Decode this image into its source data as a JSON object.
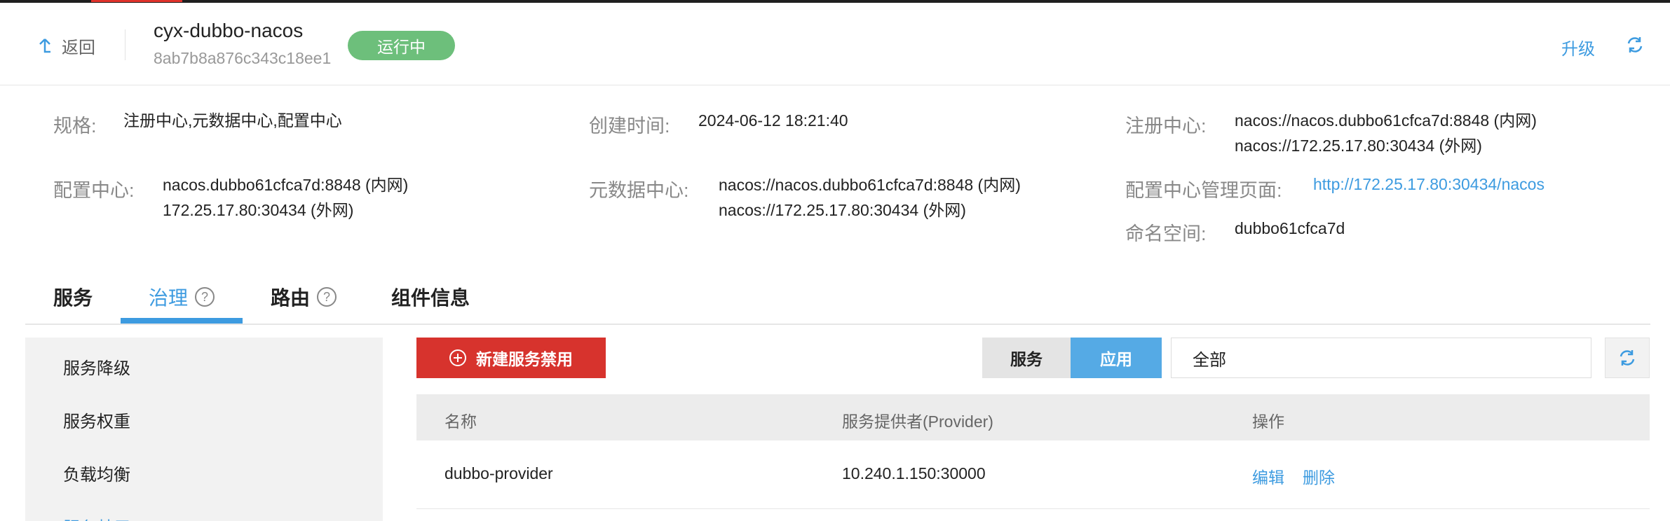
{
  "header": {
    "back_label": "返回",
    "instance_name": "cyx-dubbo-nacos",
    "instance_id": "8ab7b8a876c343c18ee1",
    "status": "运行中",
    "upgrade_label": "升级"
  },
  "info": {
    "spec_label": "规格:",
    "spec_value": "注册中心,元数据中心,配置中心",
    "created_label": "创建时间:",
    "created_value": "2024-06-12 18:21:40",
    "registry_label": "注册中心:",
    "registry_internal": "nacos://nacos.dubbo61cfca7d:8848 (内网)",
    "registry_external": "nacos://172.25.17.80:30434 (外网)",
    "config_label": "配置中心:",
    "config_internal": "nacos.dubbo61cfca7d:8848 (内网)",
    "config_external": "172.25.17.80:30434 (外网)",
    "metadata_label": "元数据中心:",
    "metadata_internal": "nacos://nacos.dubbo61cfca7d:8848 (内网)",
    "metadata_external": "nacos://172.25.17.80:30434 (外网)",
    "config_page_label": "配置中心管理页面:",
    "config_page_url": "http://172.25.17.80:30434/nacos",
    "namespace_label": "命名空间:",
    "namespace_value": "dubbo61cfca7d"
  },
  "tabs": [
    {
      "label": "服务"
    },
    {
      "label": "治理"
    },
    {
      "label": "路由"
    },
    {
      "label": "组件信息"
    }
  ],
  "sidebar": {
    "items": [
      {
        "label": "服务降级"
      },
      {
        "label": "服务权重"
      },
      {
        "label": "负载均衡"
      },
      {
        "label": "服务禁用"
      }
    ]
  },
  "toolbar": {
    "new_button": "新建服务禁用",
    "seg_service": "服务",
    "seg_app": "应用",
    "filter_value": "全部"
  },
  "table": {
    "columns": [
      "名称",
      "服务提供者(Provider)",
      "操作"
    ],
    "rows": [
      {
        "name": "dubbo-provider",
        "provider": "10.240.1.150:30000",
        "edit": "编辑",
        "delete": "删除"
      }
    ]
  },
  "colors": {
    "accent": "#3d9be0",
    "status_green": "#6dbf7b",
    "danger_red": "#d7332d"
  }
}
